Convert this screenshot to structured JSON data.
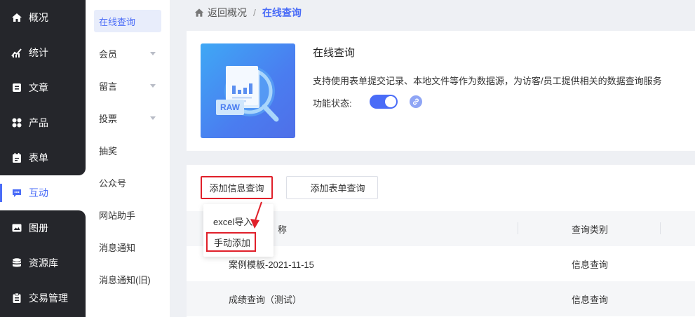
{
  "nav": {
    "items": [
      {
        "label": "概况",
        "icon": "home-icon"
      },
      {
        "label": "统计",
        "icon": "stats-icon"
      },
      {
        "label": "文章",
        "icon": "article-icon"
      },
      {
        "label": "产品",
        "icon": "product-icon"
      },
      {
        "label": "表单",
        "icon": "form-icon"
      },
      {
        "label": "互动",
        "icon": "chat-icon"
      },
      {
        "label": "图册",
        "icon": "album-icon"
      },
      {
        "label": "资源库",
        "icon": "database-icon"
      },
      {
        "label": "交易管理",
        "icon": "clipboard-icon"
      }
    ],
    "active_label": "互动"
  },
  "subnav": {
    "items": [
      {
        "label": "在线查询"
      },
      {
        "label": "会员"
      },
      {
        "label": "留言"
      },
      {
        "label": "投票"
      },
      {
        "label": "抽奖"
      },
      {
        "label": "公众号"
      },
      {
        "label": "网站助手"
      },
      {
        "label": "消息通知"
      },
      {
        "label": "消息通知(旧)"
      }
    ]
  },
  "breadcrumb": {
    "back": "返回概况",
    "separator": "/",
    "current": "在线查询"
  },
  "intro": {
    "hero_badge": "RAW",
    "title": "在线查询",
    "description": "支持使用表单提交记录、本地文件等作为数据源，为访客/员工提供相关的数据查询服务",
    "status_label": "功能状态:"
  },
  "toolbar": {
    "add_info_query": "添加信息查询",
    "add_form_query": "添加表单查询"
  },
  "dropdown": {
    "options": [
      "excel导入",
      "手动添加"
    ]
  },
  "table": {
    "headers": [
      "名称",
      "查询类别"
    ],
    "header_name_visible": "称",
    "rows": [
      {
        "name": "案例模板-2021-11-15",
        "type": "信息查询"
      },
      {
        "name": "成绩查询（测试）",
        "type": "信息查询"
      }
    ]
  },
  "colors": {
    "accent": "#4a6cf7",
    "nav_bg": "#25262b",
    "highlight_red": "#e0202a"
  }
}
